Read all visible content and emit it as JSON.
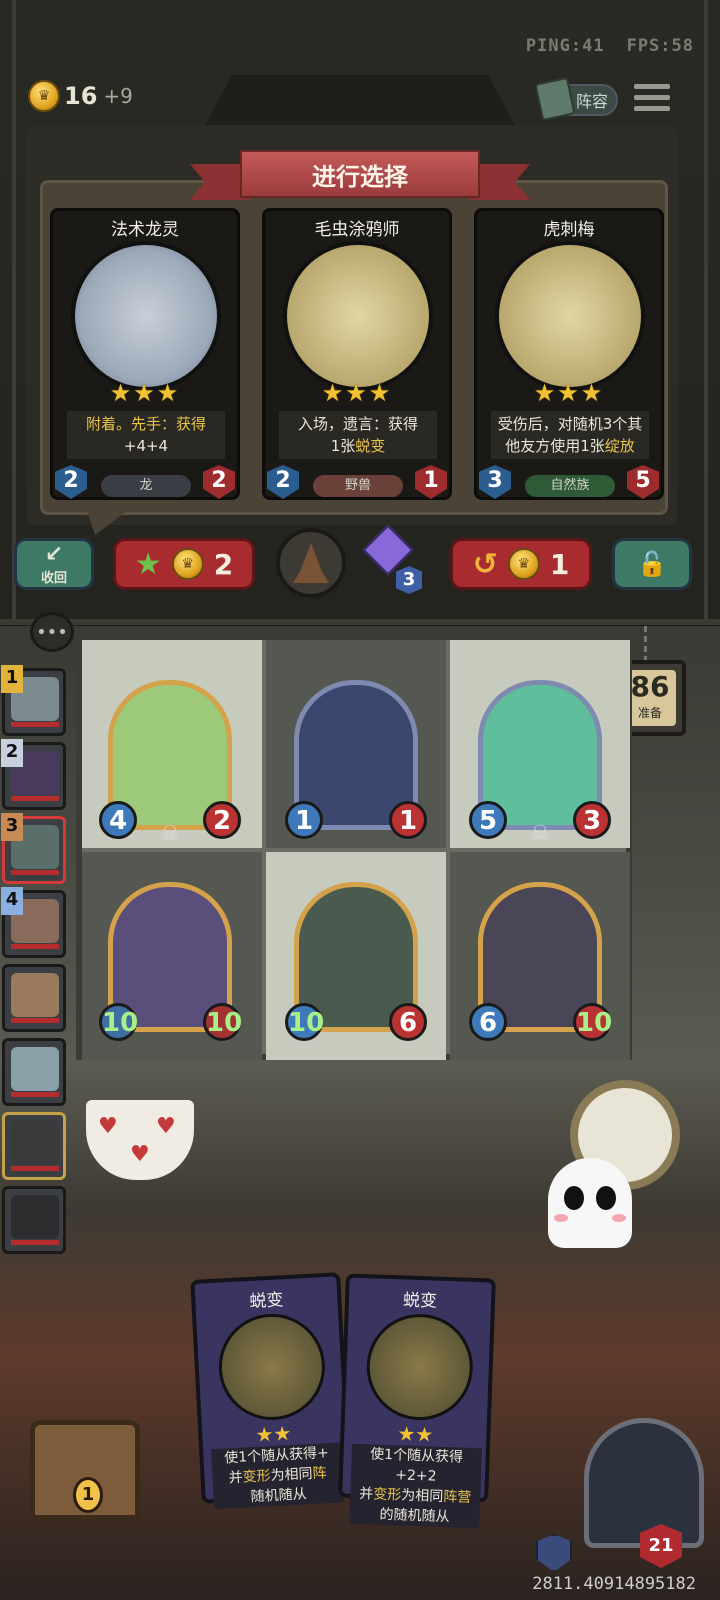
{
  "hud": {
    "ping": "PING:41",
    "fps": "FPS:58",
    "gold": "16",
    "gold_income": "+9",
    "lineup_label": "阵容"
  },
  "selection": {
    "banner": "进行选择",
    "cards": [
      {
        "name": "法术龙灵",
        "stars": "★★★",
        "desc_plain": "附着。先手：获得",
        "desc_kw": "",
        "desc_tail": "+4+4",
        "tribe": "龙",
        "attack": "2",
        "health": "2",
        "tribe_color": "#3a3e44"
      },
      {
        "name": "毛虫涂鸦师",
        "stars": "★★★",
        "desc_plain": "入场，遗言：获得",
        "desc_kw": "蜕变",
        "desc_tail": "1张",
        "tribe": "野兽",
        "attack": "2",
        "health": "1",
        "tribe_color": "#6a4038"
      },
      {
        "name": "虎刺梅",
        "stars": "★★★",
        "desc_plain": "受伤后，对随机3个其他友方使用1张",
        "desc_kw": "绽放",
        "desc_tail": "",
        "tribe": "自然族",
        "attack": "3",
        "health": "5",
        "tribe_color": "#2e5a36"
      }
    ]
  },
  "actions": {
    "recall_label": "收回",
    "upgrade_cost": "2",
    "refresh_cost": "1",
    "gem_count": "3"
  },
  "timer": {
    "value": "86",
    "label": "准备"
  },
  "players": [
    {
      "rank": "1",
      "rank_color": "#e2b43c"
    },
    {
      "rank": "2",
      "rank_color": "#c8d0e0"
    },
    {
      "rank": "3",
      "rank_color": "#c98a55"
    },
    {
      "rank": "4",
      "rank_color": "#8ab0e0"
    },
    {
      "rank": "",
      "rank_color": ""
    },
    {
      "rank": "",
      "rank_color": ""
    },
    {
      "rank": "",
      "rank_color": ""
    },
    {
      "rank": "",
      "rank_color": ""
    }
  ],
  "board": [
    {
      "attack": "4",
      "health": "2",
      "skull": true
    },
    {
      "attack": "1",
      "health": "1",
      "skull": false
    },
    {
      "attack": "5",
      "health": "3",
      "skull": true
    },
    {
      "attack": "10",
      "health": "10",
      "skull": false
    },
    {
      "attack": "10",
      "health": "6",
      "skull": false
    },
    {
      "attack": "6",
      "health": "10",
      "skull": false
    }
  ],
  "hand": [
    {
      "title": "蜕变",
      "stars": "★★",
      "desc_a": "使1个随从获得+",
      "desc_b": "并",
      "desc_kw1": "变形",
      "desc_c": "为相同",
      "desc_kw2": "阵",
      "desc_d": "随机随从"
    },
    {
      "title": "蜕变",
      "stars": "★★",
      "desc_a": "使1个随从获得+2+2",
      "desc_b": "并",
      "desc_kw1": "变形",
      "desc_c": "为相同",
      "desc_kw2": "阵营",
      "desc_d": "的随机随从"
    }
  ],
  "chest_count": "1",
  "hero_health": "21",
  "session_id": "2811.40914895182"
}
